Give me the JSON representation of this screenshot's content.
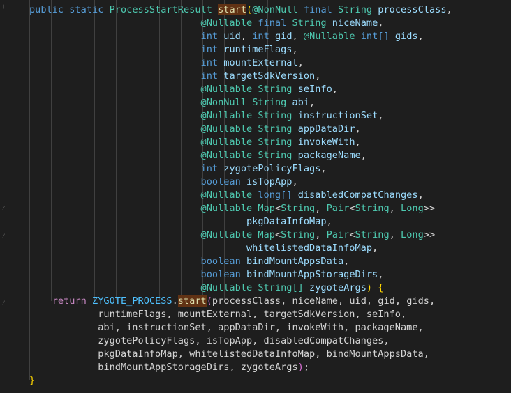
{
  "editor": {
    "lines": [
      [
        {
          "t": "    ",
          "c": ""
        },
        {
          "t": "public",
          "c": "kw"
        },
        {
          "t": " ",
          "c": ""
        },
        {
          "t": "static",
          "c": "kw"
        },
        {
          "t": " ",
          "c": ""
        },
        {
          "t": "ProcessStartResult",
          "c": "ty"
        },
        {
          "t": " ",
          "c": ""
        },
        {
          "t": "start",
          "c": "hl"
        },
        {
          "t": "(",
          "c": "brace"
        },
        {
          "t": "@NonNull",
          "c": "ty"
        },
        {
          "t": " ",
          "c": ""
        },
        {
          "t": "final",
          "c": "kw"
        },
        {
          "t": " ",
          "c": ""
        },
        {
          "t": "String",
          "c": "ty"
        },
        {
          "t": " ",
          "c": ""
        },
        {
          "t": "processClass",
          "c": "var"
        },
        {
          "t": ",",
          "c": ""
        }
      ],
      [
        {
          "t": "                                  ",
          "c": ""
        },
        {
          "t": "@Nullable",
          "c": "ty"
        },
        {
          "t": " ",
          "c": ""
        },
        {
          "t": "final",
          "c": "kw"
        },
        {
          "t": " ",
          "c": ""
        },
        {
          "t": "String",
          "c": "ty"
        },
        {
          "t": " ",
          "c": ""
        },
        {
          "t": "niceName",
          "c": "var"
        },
        {
          "t": ",",
          "c": ""
        }
      ],
      [
        {
          "t": "                                  ",
          "c": ""
        },
        {
          "t": "int",
          "c": "kw"
        },
        {
          "t": " ",
          "c": ""
        },
        {
          "t": "uid",
          "c": "var"
        },
        {
          "t": ", ",
          "c": ""
        },
        {
          "t": "int",
          "c": "kw"
        },
        {
          "t": " ",
          "c": ""
        },
        {
          "t": "gid",
          "c": "var"
        },
        {
          "t": ", ",
          "c": ""
        },
        {
          "t": "@Nullable",
          "c": "ty"
        },
        {
          "t": " ",
          "c": ""
        },
        {
          "t": "int",
          "c": "kw"
        },
        {
          "t": "[]",
          "c": "kw"
        },
        {
          "t": " ",
          "c": ""
        },
        {
          "t": "gids",
          "c": "var"
        },
        {
          "t": ",",
          "c": ""
        }
      ],
      [
        {
          "t": "                                  ",
          "c": ""
        },
        {
          "t": "int",
          "c": "kw"
        },
        {
          "t": " ",
          "c": ""
        },
        {
          "t": "runtimeFlags",
          "c": "var"
        },
        {
          "t": ",",
          "c": ""
        }
      ],
      [
        {
          "t": "                                  ",
          "c": ""
        },
        {
          "t": "int",
          "c": "kw"
        },
        {
          "t": " ",
          "c": ""
        },
        {
          "t": "mountExternal",
          "c": "var"
        },
        {
          "t": ",",
          "c": ""
        }
      ],
      [
        {
          "t": "                                  ",
          "c": ""
        },
        {
          "t": "int",
          "c": "kw"
        },
        {
          "t": " ",
          "c": ""
        },
        {
          "t": "targetSdkVersion",
          "c": "var"
        },
        {
          "t": ",",
          "c": ""
        }
      ],
      [
        {
          "t": "                                  ",
          "c": ""
        },
        {
          "t": "@Nullable",
          "c": "ty"
        },
        {
          "t": " ",
          "c": ""
        },
        {
          "t": "String",
          "c": "ty"
        },
        {
          "t": " ",
          "c": ""
        },
        {
          "t": "seInfo",
          "c": "var"
        },
        {
          "t": ",",
          "c": ""
        }
      ],
      [
        {
          "t": "                                  ",
          "c": ""
        },
        {
          "t": "@NonNull",
          "c": "ty"
        },
        {
          "t": " ",
          "c": ""
        },
        {
          "t": "String",
          "c": "ty"
        },
        {
          "t": " ",
          "c": ""
        },
        {
          "t": "abi",
          "c": "var"
        },
        {
          "t": ",",
          "c": ""
        }
      ],
      [
        {
          "t": "                                  ",
          "c": ""
        },
        {
          "t": "@Nullable",
          "c": "ty"
        },
        {
          "t": " ",
          "c": ""
        },
        {
          "t": "String",
          "c": "ty"
        },
        {
          "t": " ",
          "c": ""
        },
        {
          "t": "instructionSet",
          "c": "var"
        },
        {
          "t": ",",
          "c": ""
        }
      ],
      [
        {
          "t": "                                  ",
          "c": ""
        },
        {
          "t": "@Nullable",
          "c": "ty"
        },
        {
          "t": " ",
          "c": ""
        },
        {
          "t": "String",
          "c": "ty"
        },
        {
          "t": " ",
          "c": ""
        },
        {
          "t": "appDataDir",
          "c": "var"
        },
        {
          "t": ",",
          "c": ""
        }
      ],
      [
        {
          "t": "                                  ",
          "c": ""
        },
        {
          "t": "@Nullable",
          "c": "ty"
        },
        {
          "t": " ",
          "c": ""
        },
        {
          "t": "String",
          "c": "ty"
        },
        {
          "t": " ",
          "c": ""
        },
        {
          "t": "invokeWith",
          "c": "var"
        },
        {
          "t": ",",
          "c": ""
        }
      ],
      [
        {
          "t": "                                  ",
          "c": ""
        },
        {
          "t": "@Nullable",
          "c": "ty"
        },
        {
          "t": " ",
          "c": ""
        },
        {
          "t": "String",
          "c": "ty"
        },
        {
          "t": " ",
          "c": ""
        },
        {
          "t": "packageName",
          "c": "var"
        },
        {
          "t": ",",
          "c": ""
        }
      ],
      [
        {
          "t": "                                  ",
          "c": ""
        },
        {
          "t": "int",
          "c": "kw"
        },
        {
          "t": " ",
          "c": ""
        },
        {
          "t": "zygotePolicyFlags",
          "c": "var"
        },
        {
          "t": ",",
          "c": ""
        }
      ],
      [
        {
          "t": "                                  ",
          "c": ""
        },
        {
          "t": "boolean",
          "c": "kw"
        },
        {
          "t": " ",
          "c": ""
        },
        {
          "t": "isTopApp",
          "c": "var"
        },
        {
          "t": ",",
          "c": ""
        }
      ],
      [
        {
          "t": "                                  ",
          "c": ""
        },
        {
          "t": "@Nullable",
          "c": "ty"
        },
        {
          "t": " ",
          "c": ""
        },
        {
          "t": "long",
          "c": "kw"
        },
        {
          "t": "[]",
          "c": "kw"
        },
        {
          "t": " ",
          "c": ""
        },
        {
          "t": "disabledCompatChanges",
          "c": "var"
        },
        {
          "t": ",",
          "c": ""
        }
      ],
      [
        {
          "t": "                                  ",
          "c": ""
        },
        {
          "t": "@Nullable",
          "c": "ty"
        },
        {
          "t": " ",
          "c": ""
        },
        {
          "t": "Map",
          "c": "ty"
        },
        {
          "t": "<",
          "c": ""
        },
        {
          "t": "String",
          "c": "ty"
        },
        {
          "t": ", ",
          "c": ""
        },
        {
          "t": "Pair",
          "c": "ty"
        },
        {
          "t": "<",
          "c": ""
        },
        {
          "t": "String",
          "c": "ty"
        },
        {
          "t": ", ",
          "c": ""
        },
        {
          "t": "Long",
          "c": "ty"
        },
        {
          "t": ">>",
          "c": ""
        }
      ],
      [
        {
          "t": "                                          ",
          "c": ""
        },
        {
          "t": "pkgDataInfoMap",
          "c": "var"
        },
        {
          "t": ",",
          "c": ""
        }
      ],
      [
        {
          "t": "                                  ",
          "c": ""
        },
        {
          "t": "@Nullable",
          "c": "ty"
        },
        {
          "t": " ",
          "c": ""
        },
        {
          "t": "Map",
          "c": "ty"
        },
        {
          "t": "<",
          "c": ""
        },
        {
          "t": "String",
          "c": "ty"
        },
        {
          "t": ", ",
          "c": ""
        },
        {
          "t": "Pair",
          "c": "ty"
        },
        {
          "t": "<",
          "c": ""
        },
        {
          "t": "String",
          "c": "ty"
        },
        {
          "t": ", ",
          "c": ""
        },
        {
          "t": "Long",
          "c": "ty"
        },
        {
          "t": ">>",
          "c": ""
        }
      ],
      [
        {
          "t": "                                          ",
          "c": ""
        },
        {
          "t": "whitelistedDataInfoMap",
          "c": "var"
        },
        {
          "t": ",",
          "c": ""
        }
      ],
      [
        {
          "t": "                                  ",
          "c": ""
        },
        {
          "t": "boolean",
          "c": "kw"
        },
        {
          "t": " ",
          "c": ""
        },
        {
          "t": "bindMountAppsData",
          "c": "var"
        },
        {
          "t": ",",
          "c": ""
        }
      ],
      [
        {
          "t": "                                  ",
          "c": ""
        },
        {
          "t": "boolean",
          "c": "kw"
        },
        {
          "t": " ",
          "c": ""
        },
        {
          "t": "bindMountAppStorageDirs",
          "c": "var"
        },
        {
          "t": ",",
          "c": ""
        }
      ],
      [
        {
          "t": "                                  ",
          "c": ""
        },
        {
          "t": "@Nullable",
          "c": "ty"
        },
        {
          "t": " ",
          "c": ""
        },
        {
          "t": "String",
          "c": "ty"
        },
        {
          "t": "[]",
          "c": "ty"
        },
        {
          "t": " ",
          "c": ""
        },
        {
          "t": "zygoteArgs",
          "c": "var"
        },
        {
          "t": ")",
          "c": "brace"
        },
        {
          "t": " ",
          "c": ""
        },
        {
          "t": "{",
          "c": "brace"
        }
      ],
      [
        {
          "t": "        ",
          "c": ""
        },
        {
          "t": "return",
          "c": "ctl"
        },
        {
          "t": " ",
          "c": ""
        },
        {
          "t": "ZYGOTE_PROCESS",
          "c": "cst"
        },
        {
          "t": ".",
          "c": ""
        },
        {
          "t": "start",
          "c": "hl"
        },
        {
          "t": "(",
          "c": "brace2"
        },
        {
          "t": "processClass",
          "c": ""
        },
        {
          "t": ", ",
          "c": ""
        },
        {
          "t": "niceName",
          "c": ""
        },
        {
          "t": ", ",
          "c": ""
        },
        {
          "t": "uid",
          "c": ""
        },
        {
          "t": ", ",
          "c": ""
        },
        {
          "t": "gid",
          "c": ""
        },
        {
          "t": ", ",
          "c": ""
        },
        {
          "t": "gids",
          "c": ""
        },
        {
          "t": ",",
          "c": ""
        }
      ],
      [
        {
          "t": "                ",
          "c": ""
        },
        {
          "t": "runtimeFlags, mountExternal, targetSdkVersion, seInfo,",
          "c": ""
        }
      ],
      [
        {
          "t": "                ",
          "c": ""
        },
        {
          "t": "abi, instructionSet, appDataDir, invokeWith, packageName,",
          "c": ""
        }
      ],
      [
        {
          "t": "                ",
          "c": ""
        },
        {
          "t": "zygotePolicyFlags, isTopApp, disabledCompatChanges,",
          "c": ""
        }
      ],
      [
        {
          "t": "                ",
          "c": ""
        },
        {
          "t": "pkgDataInfoMap, whitelistedDataInfoMap, bindMountAppsData,",
          "c": ""
        }
      ],
      [
        {
          "t": "                ",
          "c": ""
        },
        {
          "t": "bindMountAppStorageDirs, zygoteArgs",
          "c": ""
        },
        {
          "t": ")",
          "c": "brace2"
        },
        {
          "t": ";",
          "c": ""
        }
      ],
      [
        {
          "t": "    ",
          "c": ""
        },
        {
          "t": "}",
          "c": "brace"
        }
      ]
    ]
  }
}
